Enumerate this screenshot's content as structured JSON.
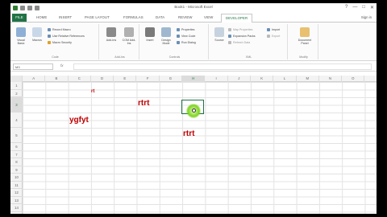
{
  "window": {
    "title": "Book1 - Microsoft Excel",
    "controls": [
      "?",
      "—",
      "□",
      "✕"
    ],
    "signin": "Sign in"
  },
  "tabs": [
    "FILE",
    "HOME",
    "INSERT",
    "PAGE LAYOUT",
    "FORMULAS",
    "DATA",
    "REVIEW",
    "VIEW",
    "DEVELOPER"
  ],
  "ribbon": {
    "code": {
      "label": "Code",
      "visual_basic": "Visual Basic",
      "macros": "Macros",
      "record_macro": "Record Macro",
      "use_relative": "Use Relative References",
      "macro_security": "Macro Security"
    },
    "addins": {
      "label": "Add-Ins",
      "addins": "Add-Ins",
      "com_addins": "COM Add-Ins"
    },
    "controls": {
      "label": "Controls",
      "insert": "Insert",
      "design_mode": "Design Mode",
      "properties": "Properties",
      "view_code": "View Code",
      "run_dialog": "Run Dialog"
    },
    "xml": {
      "label": "XML",
      "source": "Source",
      "map_properties": "Map Properties",
      "expansion_packs": "Expansion Packs",
      "refresh_data": "Refresh Data",
      "import": "Import",
      "export": "Export"
    },
    "modify": {
      "label": "Modify",
      "document_panel": "Document Panel"
    }
  },
  "formula_bar": {
    "name_box": "M3",
    "fx": "fx",
    "value": ""
  },
  "columns": [
    "A",
    "B",
    "C",
    "D",
    "E",
    "F",
    "G",
    "H",
    "I",
    "J",
    "K",
    "L",
    "M",
    "N",
    "O"
  ],
  "rows": [
    "1",
    "2",
    "3",
    "4",
    "5",
    "6",
    "7",
    "8",
    "9",
    "10",
    "11",
    "12",
    "13",
    "14",
    "15",
    "16",
    "17"
  ],
  "cells": {
    "c1": "rt",
    "c2": "rtrt",
    "c3": "ygfyt",
    "c4": "rtrt"
  },
  "colors": {
    "accent": "#217346",
    "cell_text": "#c00000"
  }
}
